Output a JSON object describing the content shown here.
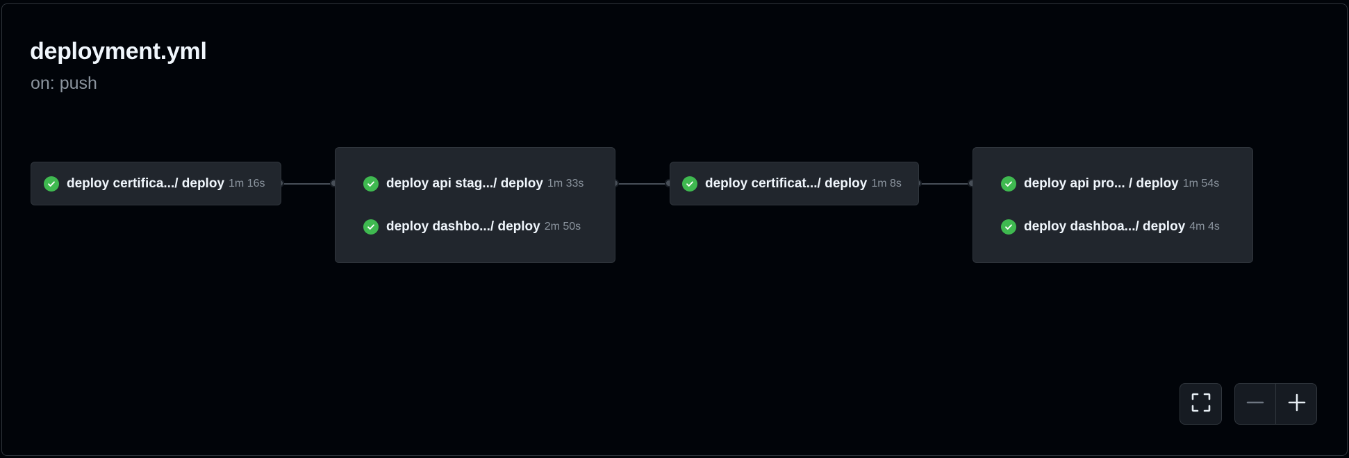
{
  "workflow": {
    "title": "deployment.yml",
    "trigger": "on: push"
  },
  "stages": [
    {
      "jobs": [
        {
          "name": "deploy certifica.../ deploy",
          "duration": "1m 16s",
          "status": "success"
        }
      ]
    },
    {
      "jobs": [
        {
          "name": "deploy api stag.../ deploy",
          "duration": "1m 33s",
          "status": "success"
        },
        {
          "name": "deploy dashbo.../ deploy",
          "duration": "2m 50s",
          "status": "success"
        }
      ]
    },
    {
      "jobs": [
        {
          "name": "deploy certificat.../ deploy",
          "duration": "1m 8s",
          "status": "success"
        }
      ]
    },
    {
      "jobs": [
        {
          "name": "deploy api pro... / deploy",
          "duration": "1m 54s",
          "status": "success"
        },
        {
          "name": "deploy dashboa.../ deploy",
          "duration": "4m 4s",
          "status": "success"
        }
      ]
    }
  ],
  "controls": {
    "fullscreen_icon": "fullscreen-icon",
    "zoom_out_icon": "minus-icon",
    "zoom_in_icon": "plus-icon"
  },
  "colors": {
    "background": "#010409",
    "card": "#21262d",
    "success": "#3fb950",
    "muted_text": "#8b949e"
  }
}
